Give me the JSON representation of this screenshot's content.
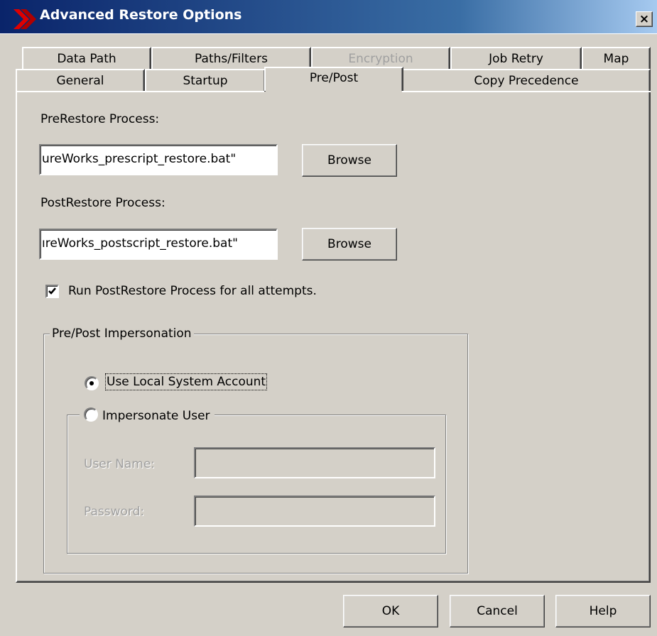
{
  "window": {
    "title": "Advanced Restore Options",
    "close_label": "×"
  },
  "tabs": {
    "row1": [
      {
        "label": "Data Path",
        "enabled": true
      },
      {
        "label": "Paths/Filters",
        "enabled": true
      },
      {
        "label": "Encryption",
        "enabled": false
      },
      {
        "label": "Job Retry",
        "enabled": true
      },
      {
        "label": "Map",
        "enabled": true
      }
    ],
    "row2": [
      {
        "label": "General",
        "enabled": true
      },
      {
        "label": "Startup",
        "enabled": true
      },
      {
        "label": "Pre/Post",
        "enabled": true,
        "active": true
      },
      {
        "label": "Copy Precedence",
        "enabled": true
      }
    ]
  },
  "pre_restore": {
    "label": "PreRestore Process:",
    "value": "ureWorks_prescript_restore.bat\"",
    "browse_label": "Browse"
  },
  "post_restore": {
    "label": "PostRestore Process:",
    "value": "ıreWorks_postscript_restore.bat\"",
    "browse_label": "Browse"
  },
  "run_post_all": {
    "label": "Run PostRestore Process for all attempts.",
    "checked": true
  },
  "impersonation": {
    "legend": "Pre/Post Impersonation",
    "use_local_label": "Use Local System Account",
    "use_local_selected": true,
    "impersonate_label": "Impersonate User",
    "impersonate_selected": false,
    "username_label": "User Name:",
    "username_value": "",
    "password_label": "Password:",
    "password_value": ""
  },
  "footer": {
    "ok_label": "OK",
    "cancel_label": "Cancel",
    "help_label": "Help"
  },
  "colors": {
    "title_bar_start": "#0a246a",
    "title_bar_end": "#a6caf0",
    "dialog_face": "#d4d0c8",
    "disabled_text": "#a0a0a0"
  }
}
